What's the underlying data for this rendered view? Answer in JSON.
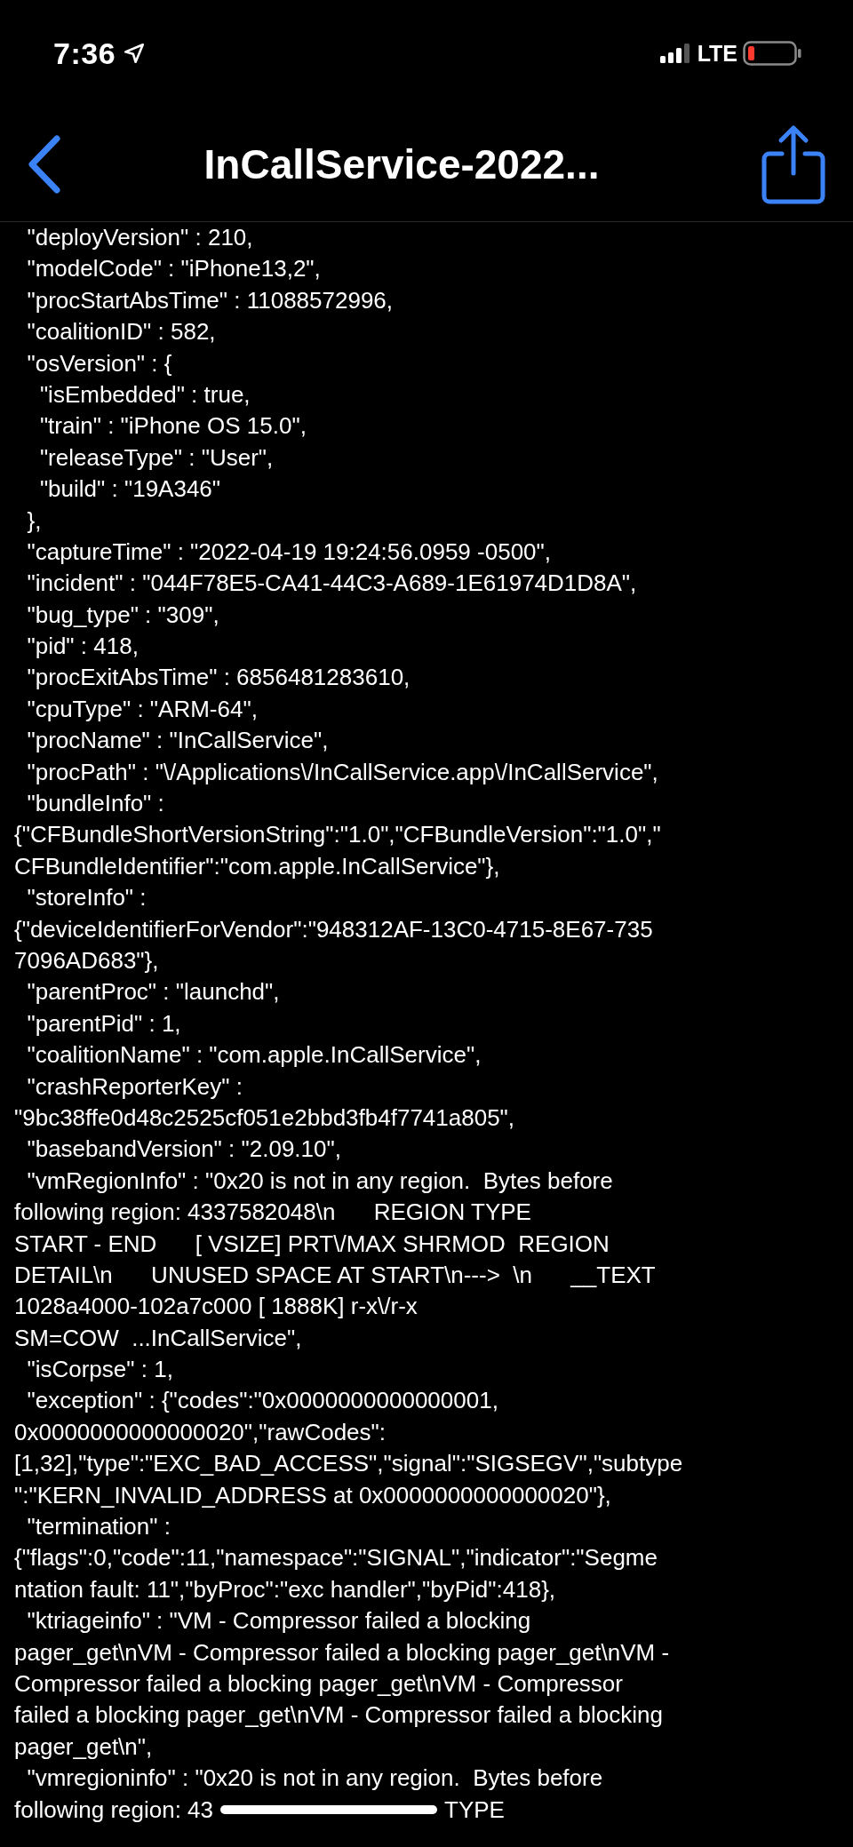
{
  "status_bar": {
    "time": "7:36",
    "network": "LTE"
  },
  "nav_bar": {
    "title": "InCallService-2022..."
  },
  "lines": [
    {
      "text": "  \"deployVersion\" : 210,"
    },
    {
      "text": "  \"modelCode\" : \"iPhone13,2\","
    },
    {
      "text": "  \"procStartAbsTime\" : 11088572996,"
    },
    {
      "text": "  \"coalitionID\" : 582,"
    },
    {
      "text": "  \"osVersion\" : {"
    },
    {
      "text": "    \"isEmbedded\" : true,"
    },
    {
      "text": "    \"train\" : \"iPhone OS 15.0\","
    },
    {
      "text": "    \"releaseType\" : \"User\","
    },
    {
      "text": "    \"build\" : \"19A346\""
    },
    {
      "text": "  },"
    },
    {
      "text": "  \"captureTime\" : \"2022-04-19 19:24:56.0959 -0500\","
    },
    {
      "text": "  \"incident\" : \"044F78E5-CA41-44C3-A689-1E61974D1D8A\","
    },
    {
      "text": "  \"bug_type\" : \"309\","
    },
    {
      "text": "  \"pid\" : 418,"
    },
    {
      "text": "  \"procExitAbsTime\" : 6856481283610,"
    },
    {
      "text": "  \"cpuType\" : \"ARM-64\","
    },
    {
      "text": "  \"procName\" : \"InCallService\","
    },
    {
      "text": "  \"procPath\" : \"\\/Applications\\/InCallService.app\\/InCallService\","
    },
    {
      "text": "  \"bundleInfo\" :"
    },
    {
      "text": "{\"CFBundleShortVersionString\":\"1.0\",\"CFBundleVersion\":\"1.0\",\""
    },
    {
      "text": "CFBundleIdentifier\":\"com.apple.InCallService\"},"
    },
    {
      "text": "  \"storeInfo\" :"
    },
    {
      "text": "{\"deviceIdentifierForVendor\":\"948312AF-13C0-4715-8E67-735"
    },
    {
      "text": "7096AD683\"},"
    },
    {
      "text": "  \"parentProc\" : \"launchd\","
    },
    {
      "text": "  \"parentPid\" : 1,"
    },
    {
      "text": "  \"coalitionName\" : \"com.apple.InCallService\","
    },
    {
      "text": "  \"crashReporterKey\" :"
    },
    {
      "text": "\"9bc38ffe0d48c2525cf051e2bbd3fb4f7741a805\","
    },
    {
      "text": "  \"basebandVersion\" : \"2.09.10\","
    },
    {
      "text": "  \"vmRegionInfo\" : \"0x20 is not in any region.  Bytes before"
    },
    {
      "text": "following region: 4337582048\\n      REGION TYPE"
    },
    {
      "text": "START - END      [ VSIZE] PRT\\/MAX SHRMOD  REGION"
    },
    {
      "text": "DETAIL\\n      UNUSED SPACE AT START\\n--->  \\n      __TEXT"
    },
    {
      "text": "1028a4000-102a7c000 [ 1888K] r-x\\/r-x"
    },
    {
      "text": "SM=COW  ...InCallService\","
    },
    {
      "text": "  \"isCorpse\" : 1,"
    },
    {
      "text": "  \"exception\" : {\"codes\":\"0x0000000000000001,"
    },
    {
      "text": "0x0000000000000020\",\"rawCodes\":"
    },
    {
      "text": "[1,32],\"type\":\"EXC_BAD_ACCESS\",\"signal\":\"SIGSEGV\",\"subtype"
    },
    {
      "text": "\":\"KERN_INVALID_ADDRESS at 0x0000000000000020\"},"
    },
    {
      "text": "  \"termination\" :"
    },
    {
      "text": "{\"flags\":0,\"code\":11,\"namespace\":\"SIGNAL\",\"indicator\":\"Segme"
    },
    {
      "text": "ntation fault: 11\",\"byProc\":\"exc handler\",\"byPid\":418},"
    },
    {
      "text": "  \"ktriageinfo\" : \"VM - Compressor failed a blocking"
    },
    {
      "text": "pager_get\\nVM - Compressor failed a blocking pager_get\\nVM -"
    },
    {
      "text": "Compressor failed a blocking pager_get\\nVM - Compressor"
    },
    {
      "text": "failed a blocking pager_get\\nVM - Compressor failed a blocking"
    },
    {
      "text": "pager_get\\n\","
    },
    {
      "text": "  \"vmregioninfo\" : \"0x20 is not in any region.  Bytes before"
    },
    {
      "text": "following region: 43",
      "tail": "TYPE"
    }
  ]
}
